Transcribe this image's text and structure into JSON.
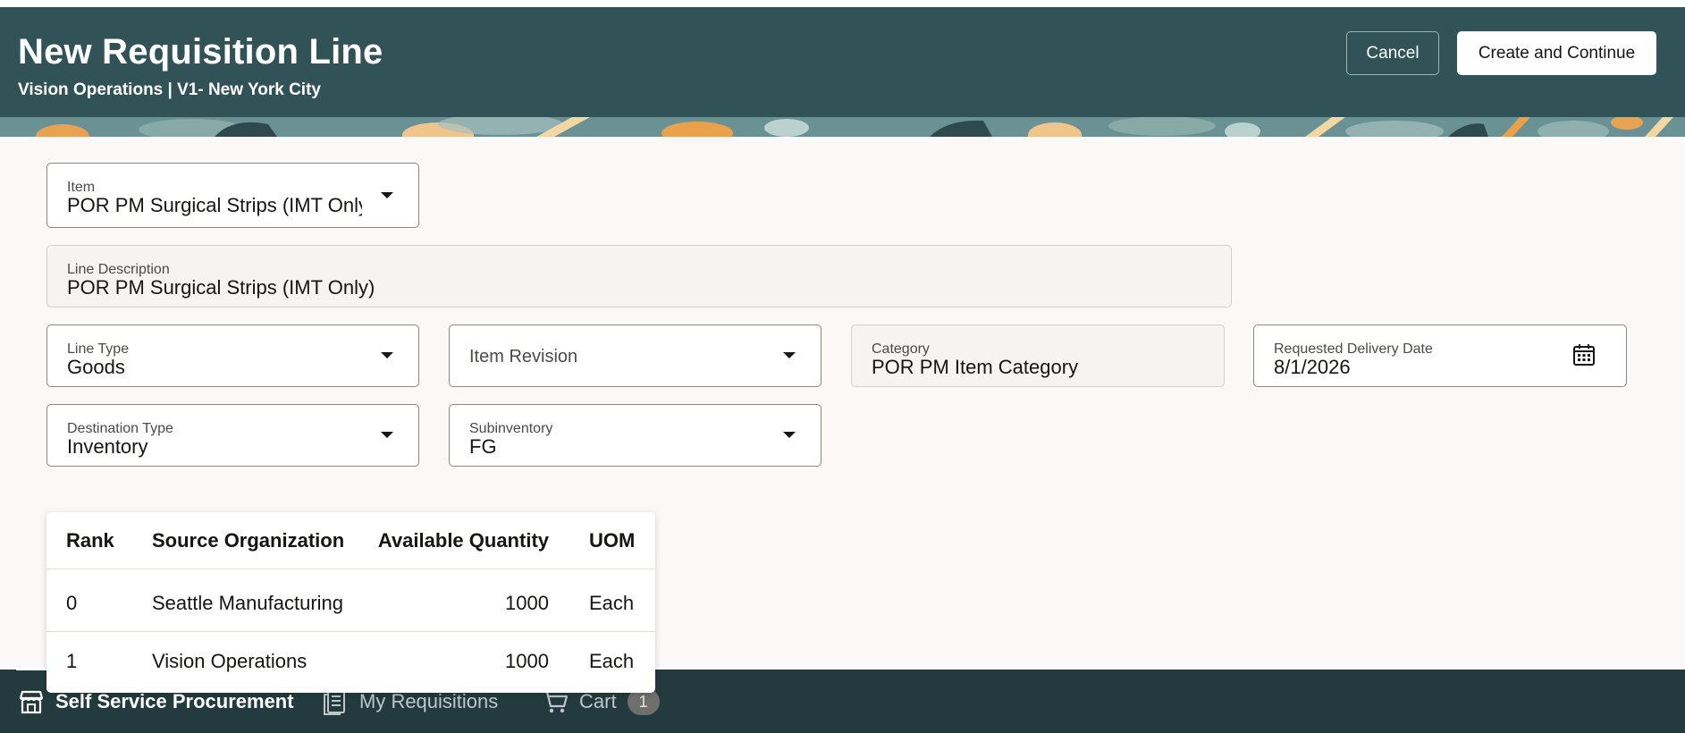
{
  "header": {
    "title": "New Requisition Line",
    "subtitle": "Vision Operations | V1- New York City",
    "cancel_label": "Cancel",
    "create_label": "Create and Continue"
  },
  "form": {
    "item": {
      "label": "Item",
      "value": "POR PM Surgical Strips (IMT Only)"
    },
    "line_description": {
      "label": "Line Description",
      "value": "POR PM Surgical Strips (IMT Only)"
    },
    "line_type": {
      "label": "Line Type",
      "value": "Goods"
    },
    "item_revision": {
      "placeholder": "Item Revision"
    },
    "category": {
      "label": "Category",
      "value": "POR PM Item Category"
    },
    "requested_delivery_date": {
      "label": "Requested Delivery Date",
      "value": "8/1/2026"
    },
    "destination_type": {
      "label": "Destination Type",
      "value": "Inventory"
    },
    "subinventory": {
      "label": "Subinventory",
      "value": "FG"
    }
  },
  "source_table": {
    "columns": [
      "Rank",
      "Source Organization",
      "Available Quantity",
      "UOM"
    ],
    "rows": [
      {
        "rank": "0",
        "org": "Seattle Manufacturing",
        "qty": "1000",
        "uom": "Each"
      },
      {
        "rank": "1",
        "org": "Vision Operations",
        "qty": "1000",
        "uom": "Each"
      }
    ]
  },
  "bottom_nav": {
    "items": [
      {
        "label": "Self Service Procurement",
        "icon": "store-icon",
        "active": true
      },
      {
        "label": "My Requisitions",
        "icon": "requisitions-icon",
        "active": false
      },
      {
        "label": "Cart",
        "icon": "cart-icon",
        "active": false
      }
    ],
    "cart_count": "1"
  },
  "colors": {
    "header_bg": "#315357",
    "bottom_bar_bg": "#233b3e",
    "content_bg": "#fbf9f8"
  }
}
